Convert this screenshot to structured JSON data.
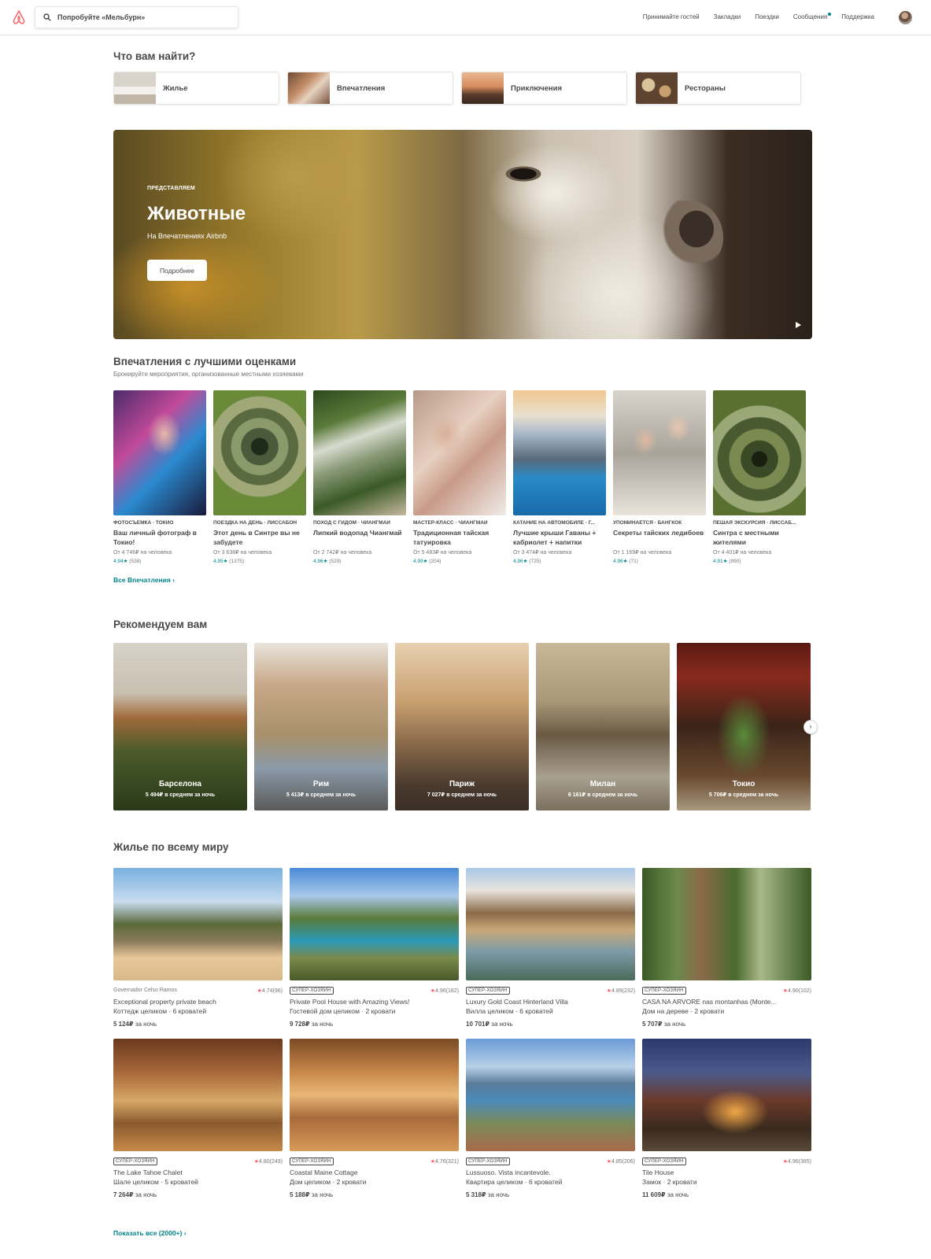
{
  "header": {
    "search_placeholder": "Попробуйте «Мельбурн»",
    "nav": [
      "Принимайте гостей",
      "Закладки",
      "Поездки",
      "Сообщения",
      "Поддержка"
    ]
  },
  "categories": {
    "title": "Что вам найти?",
    "items": [
      "Жилье",
      "Впечатления",
      "Приключения",
      "Рестораны"
    ]
  },
  "hero": {
    "kicker": "ПРЕДСТАВЛЯЕМ",
    "title": "Животные",
    "subtitle": "На Впечатлениях Airbnb",
    "button": "Подробнее"
  },
  "experiences": {
    "title": "Впечатления с лучшими оценками",
    "subtitle": "Бронируйте мероприятия, организованные местными хозяевами",
    "items": [
      {
        "category": "ФОТОСЪЕМКА · ТОКИО",
        "title": "Ваш личный фотограф в Токио!",
        "price": "От 4 746₽ на человека",
        "rating": "4.94★",
        "count": "(538)"
      },
      {
        "category": "ПОЕЗДКА НА ДЕНЬ · ЛИССАБОН",
        "title": "Этот день в Синтре вы не забудете",
        "price": "От 3 638₽ на человека",
        "rating": "4.95★",
        "count": "(1375)"
      },
      {
        "category": "ПОХОД С ГИДОМ · ЧИАНГМАЙ",
        "title": "Липкий водопад Чиангмай",
        "price": "От 2 742₽ на человека",
        "rating": "4.96★",
        "count": "(529)"
      },
      {
        "category": "МАСТЕР-КЛАСС · ЧИАНГМАЙ",
        "title": "Традиционная тайская татуировка",
        "price": "От 5 483₽ на человека",
        "rating": "4.99★",
        "count": "(204)"
      },
      {
        "category": "КАТАНИЕ НА АВТОМОБИЛЕ · Г...",
        "title": "Лучшие крыши Гаваны + кабриолет + напитки",
        "price": "От 3 474₽ на человека",
        "rating": "4.96★",
        "count": "(725)"
      },
      {
        "category": "УПОМИНАЕТСЯ · БАНГКОК",
        "title": "Секреты тайских ледибоев",
        "price": "От 1 169₽ на человека",
        "rating": "4.96★",
        "count": "(71)"
      },
      {
        "category": "ПЕШАЯ ЭКСКУРСИЯ · ЛИССАБ...",
        "title": "Синтра с местными жителями",
        "price": "От 4 401₽ на человека",
        "rating": "4.91★",
        "count": "(990)"
      }
    ],
    "all_link": "Все Впечатления ›"
  },
  "recommended": {
    "title": "Рекомендуем вам",
    "items": [
      {
        "city": "Барселона",
        "price": "5 494₽ в среднем за ночь"
      },
      {
        "city": "Рим",
        "price": "5 413₽ в среднем за ночь"
      },
      {
        "city": "Париж",
        "price": "7 027₽ в среднем за ночь"
      },
      {
        "city": "Милан",
        "price": "6 161₽ в среднем за ночь"
      },
      {
        "city": "Токио",
        "price": "5 706₽ в среднем за ночь"
      }
    ],
    "next": "›"
  },
  "homes": {
    "title": "Жилье по всему миру",
    "items": [
      {
        "badge": "",
        "location": "Governador Celso Ramos",
        "rating": "4.74",
        "count": "(96)",
        "title": "Exceptional property private beach",
        "type": "Коттедж целиком · 6 кроватей",
        "price": "5 124₽",
        "per": "за ночь"
      },
      {
        "badge": "СУПЕР-ХОЗЯИН",
        "location": "",
        "rating": "4.96",
        "count": "(182)",
        "title": "Private Pool House with Amazing Views!",
        "type": "Гостевой дом целиком · 2 кровати",
        "price": "9 728₽",
        "per": "за ночь"
      },
      {
        "badge": "СУПЕР-ХОЗЯИН",
        "location": "",
        "rating": "4.89",
        "count": "(232)",
        "title": "Luxury Gold Coast Hinterland Villa",
        "type": "Вилла целиком · 6 кроватей",
        "price": "10 701₽",
        "per": "за ночь"
      },
      {
        "badge": "СУПЕР-ХОЗЯИН",
        "location": "",
        "rating": "4.90",
        "count": "(102)",
        "title": "CASA NA ARVORE nas montanhas (Monte...",
        "type": "Дом на дереве · 2 кровати",
        "price": "5 707₽",
        "per": "за ночь"
      },
      {
        "badge": "СУПЕР-ХОЗЯИН",
        "location": "",
        "rating": "4.80",
        "count": "(249)",
        "title": "The Lake Tahoe Chalet",
        "type": "Шале целиком · 5 кроватей",
        "price": "7 264₽",
        "per": "за ночь"
      },
      {
        "badge": "СУПЕР-ХОЗЯИН",
        "location": "",
        "rating": "4.76",
        "count": "(321)",
        "title": "Coastal Maine Cottage",
        "type": "Дом целиком · 2 кровати",
        "price": "5 188₽",
        "per": "за ночь"
      },
      {
        "badge": "СУПЕР-ХОЗЯИН",
        "location": "",
        "rating": "4.85",
        "count": "(206)",
        "title": "Lussuoso. Vista incantevole.",
        "type": "Квартира целиком · 6 кроватей",
        "price": "5 318₽",
        "per": "за ночь"
      },
      {
        "badge": "СУПЕР-ХОЗЯИН",
        "location": "",
        "rating": "4.96",
        "count": "(385)",
        "title": "Tile House",
        "type": "Замок · 2 кровати",
        "price": "11 609₽",
        "per": "за ночь"
      }
    ],
    "show_all": "Показать все (2000+) ›"
  },
  "colors": {
    "brand": "#ff5a5f",
    "accent": "#008489",
    "text": "#484848"
  }
}
